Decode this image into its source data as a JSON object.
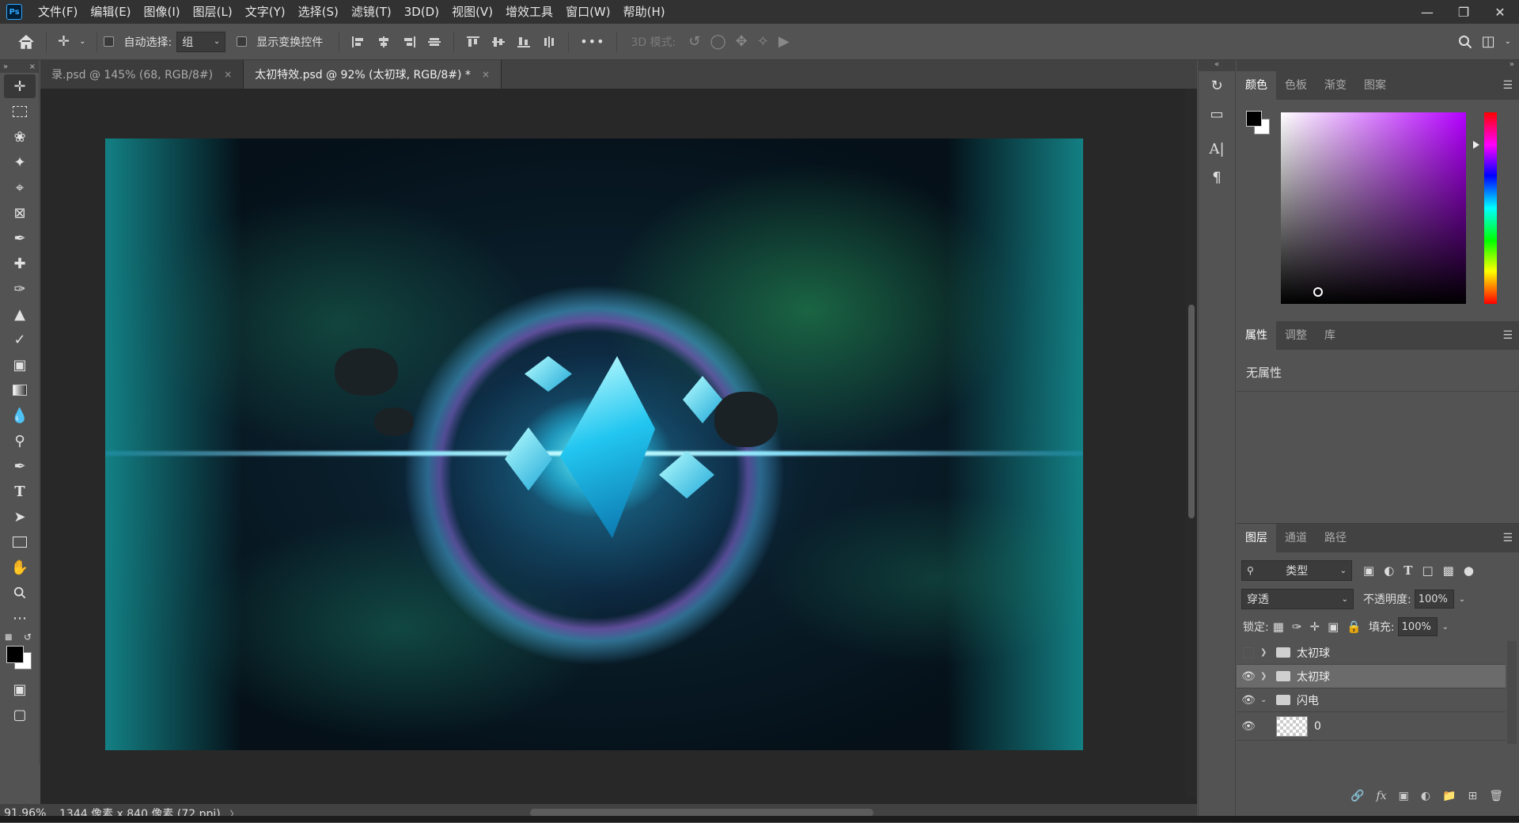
{
  "app": {
    "logo": "Ps"
  },
  "menu": [
    "文件(F)",
    "编辑(E)",
    "图像(I)",
    "图层(L)",
    "文字(Y)",
    "选择(S)",
    "滤镜(T)",
    "3D(D)",
    "视图(V)",
    "增效工具",
    "窗口(W)",
    "帮助(H)"
  ],
  "options": {
    "auto_select_label": "自动选择:",
    "auto_select_value": "组",
    "show_transform_label": "显示变换控件",
    "more": "•••",
    "mode_3d_label": "3D 模式:"
  },
  "tabs": [
    {
      "label": "录.psd @ 145% (68, RGB/8#)",
      "close": "×"
    },
    {
      "label": "太初特效.psd @ 92% (太初球, RGB/8#) *",
      "close": "×"
    }
  ],
  "status": {
    "zoom": "91.96%",
    "info": "1344 像素 x 840 像素 (72 ppi)",
    "arrow": "〉"
  },
  "color_panel": {
    "tabs": [
      "颜色",
      "色板",
      "渐变",
      "图案"
    ]
  },
  "properties_panel": {
    "tabs": [
      "属性",
      "调整",
      "库"
    ],
    "empty_text": "无属性"
  },
  "layers_panel": {
    "tabs": [
      "图层",
      "通道",
      "路径"
    ],
    "filter_label": "类型",
    "blend_mode": "穿透",
    "opacity_label": "不透明度:",
    "opacity_value": "100%",
    "lock_label": "锁定:",
    "fill_label": "填充:",
    "fill_value": "100%",
    "layers": [
      {
        "name": "太初球",
        "visible": false,
        "type": "group",
        "expanded": false,
        "selected": false
      },
      {
        "name": "太初球",
        "visible": true,
        "type": "group",
        "expanded": false,
        "selected": true
      },
      {
        "name": "闪电",
        "visible": true,
        "type": "group",
        "expanded": true,
        "selected": false
      },
      {
        "name": "0",
        "visible": true,
        "type": "layer",
        "expanded": false,
        "selected": false
      }
    ],
    "footer_fx": "fx"
  },
  "colors": {
    "fg": "#000000",
    "bg": "#ffffff",
    "accent": "#31a8ff"
  }
}
